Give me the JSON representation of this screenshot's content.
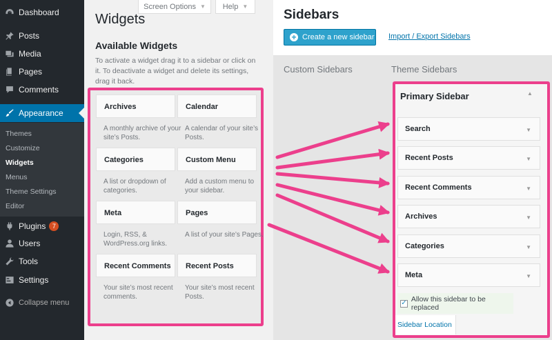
{
  "admin_menu": {
    "items": [
      {
        "label": "Dashboard",
        "icon": "dashboard-icon"
      },
      {
        "label": "Posts",
        "icon": "pin-icon"
      },
      {
        "label": "Media",
        "icon": "media-icon"
      },
      {
        "label": "Pages",
        "icon": "pages-icon"
      },
      {
        "label": "Comments",
        "icon": "comment-icon"
      },
      {
        "label": "Appearance",
        "icon": "brush-icon"
      }
    ],
    "submenu": [
      "Themes",
      "Customize",
      "Widgets",
      "Menus",
      "Theme Settings",
      "Editor"
    ],
    "lower_items": [
      {
        "label": "Plugins",
        "icon": "plugin-icon",
        "badge": "7"
      },
      {
        "label": "Users",
        "icon": "user-icon"
      },
      {
        "label": "Tools",
        "icon": "wrench-icon"
      },
      {
        "label": "Settings",
        "icon": "settings-icon"
      }
    ],
    "collapse_label": "Collapse menu"
  },
  "screen_options": "Screen Options",
  "help": "Help",
  "widgets": {
    "title": "Widgets",
    "available_title": "Available Widgets",
    "description": "To activate a widget drag it to a sidebar or click on it. To deactivate a widget and delete its settings, drag it back.",
    "items": [
      {
        "name": "Archives",
        "desc": "A monthly archive of your site’s Posts."
      },
      {
        "name": "Calendar",
        "desc": "A calendar of your site’s Posts."
      },
      {
        "name": "Categories",
        "desc": "A list or dropdown of categories."
      },
      {
        "name": "Custom Menu",
        "desc": "Add a custom menu to your sidebar."
      },
      {
        "name": "Meta",
        "desc": "Login, RSS, & WordPress.org links."
      },
      {
        "name": "Pages",
        "desc": "A list of your site’s Pages."
      },
      {
        "name": "Recent Comments",
        "desc": "Your site’s most recent comments."
      },
      {
        "name": "Recent Posts",
        "desc": "Your site’s most recent Posts."
      }
    ]
  },
  "sidebars": {
    "title": "Sidebars",
    "create_button": "Create a new sidebar",
    "import_export": "Import / Export Sidebars",
    "custom_heading": "Custom Sidebars",
    "theme_heading": "Theme Sidebars",
    "primary": {
      "title": "Primary Sidebar",
      "widgets": [
        "Search",
        "Recent Posts",
        "Recent Comments",
        "Archives",
        "Categories",
        "Meta"
      ],
      "replace_label": "Allow this sidebar to be replaced",
      "replace_checked": true,
      "location_link": "Sidebar Location"
    }
  },
  "colors": {
    "highlight": "#ec3f8c",
    "admin_bg": "#23282d",
    "accent": "#0073aa"
  }
}
